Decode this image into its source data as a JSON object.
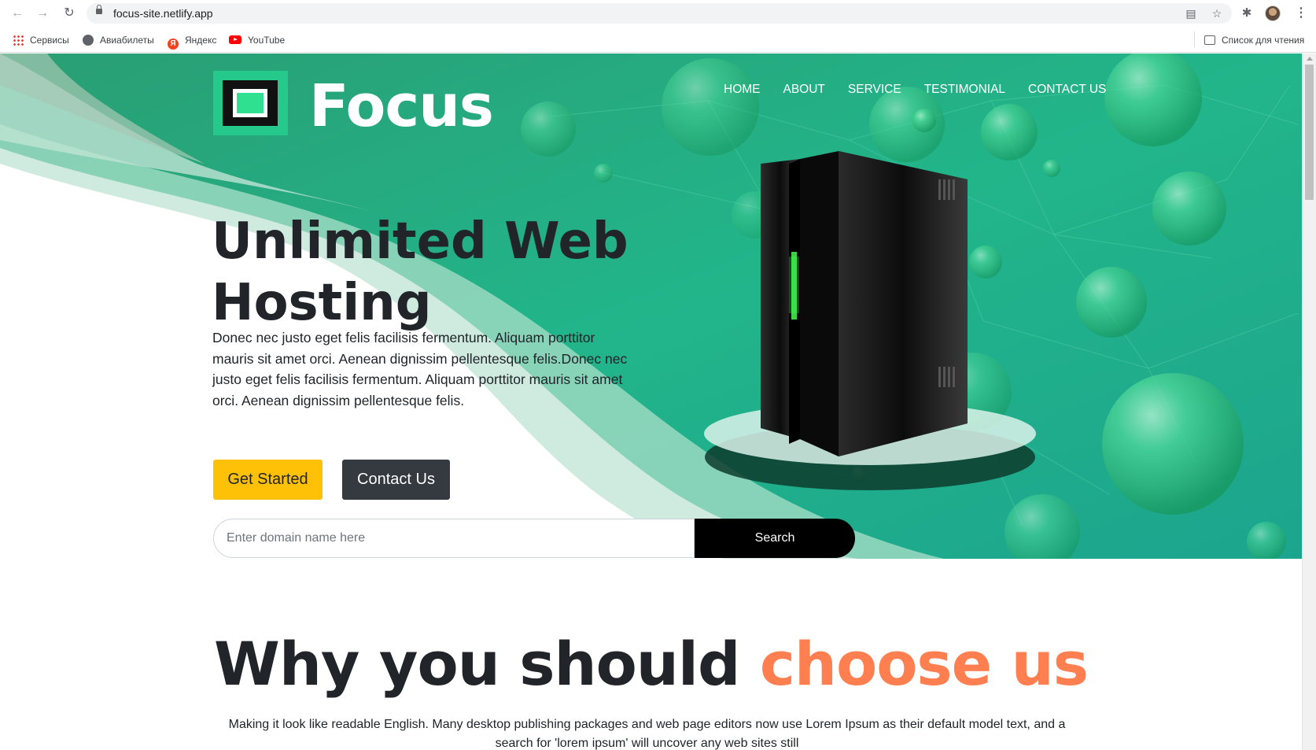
{
  "browser": {
    "url": "focus-site.netlify.app",
    "bookmarks": [
      {
        "label": "Сервисы",
        "icon": "apps-grid-icon"
      },
      {
        "label": "Авиабилеты",
        "icon": "globe-icon"
      },
      {
        "label": "Яндекс",
        "icon": "yandex-icon"
      },
      {
        "label": "YouTube",
        "icon": "youtube-icon"
      }
    ],
    "reading_list": "Список для чтения"
  },
  "site": {
    "brand": "Focus",
    "nav": [
      "HOME",
      "ABOUT",
      "SERVICE",
      "TESTIMONIAL",
      "CONTACT US"
    ],
    "hero": {
      "title": "Unlimited Web Hosting",
      "description": "Donec nec justo eget felis facilisis fermentum. Aliquam porttitor mauris sit amet orci. Aenean dignissim pellentesque felis.Donec nec justo eget felis facilisis fermentum. Aliquam porttitor mauris sit amet orci. Aenean dignissim pellentesque felis.",
      "primary_button": "Get Started",
      "secondary_button": "Contact Us",
      "search_placeholder": "Enter domain name here",
      "search_button": "Search"
    },
    "why": {
      "title_start": "Why you should ",
      "title_accent": "choose us",
      "text": "Making it look like readable English. Many desktop publishing packages and web page editors now use Lorem Ipsum as their default model text, and a search for 'lorem ipsum' will uncover any web sites still"
    }
  },
  "colors": {
    "brand_green": "#24c98b",
    "hero_teal": "#1fb58a",
    "accent_yellow": "#ffc107",
    "dark_button": "#343a40",
    "accent_coral": "#ff7f50"
  }
}
